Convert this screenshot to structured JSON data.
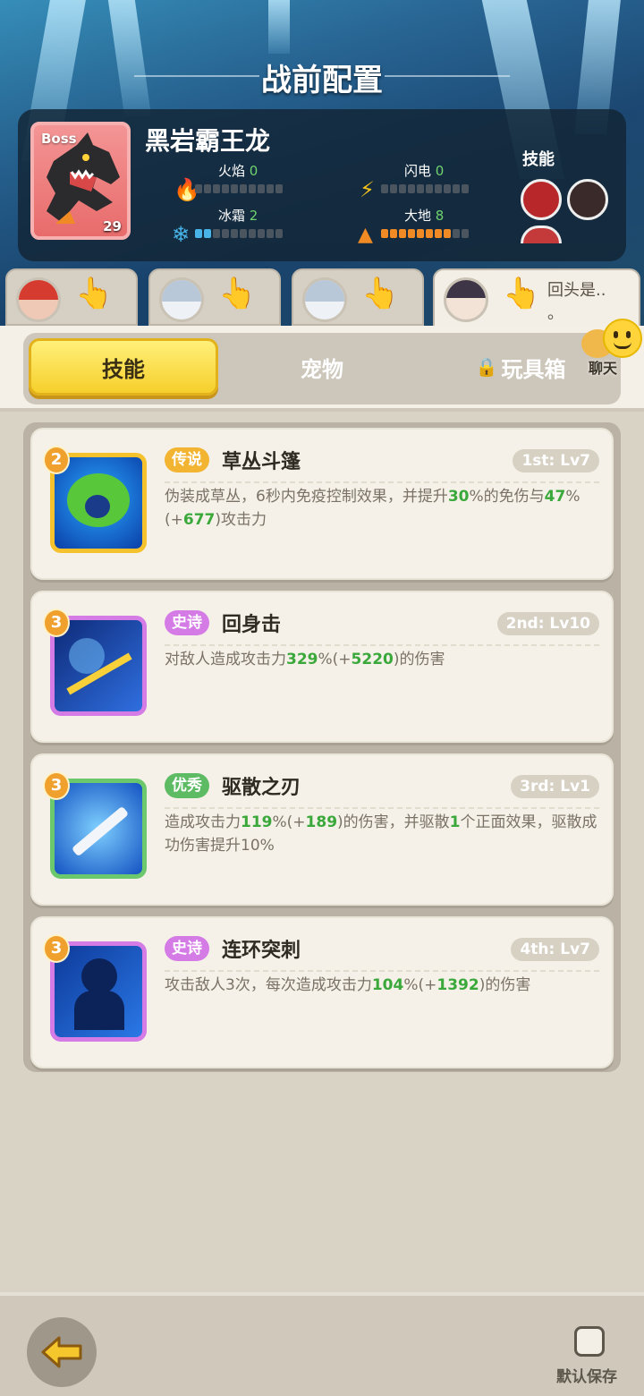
{
  "header": {
    "title": "战前配置"
  },
  "boss": {
    "tag": "Boss",
    "name": "黑岩霸王龙",
    "level": "29",
    "stats": [
      {
        "label": "火焰",
        "value": "0",
        "color": "#e0452b",
        "icon": "fire-icon"
      },
      {
        "label": "闪电",
        "value": "0",
        "color": "#f5c21c",
        "icon": "lightning-icon"
      },
      {
        "label": "冰霜",
        "value": "2",
        "color": "#48b4e8",
        "icon": "snowflake-icon"
      },
      {
        "label": "大地",
        "value": "8",
        "color": "#f08a24",
        "icon": "earth-icon"
      }
    ],
    "skills_label": "技能"
  },
  "characters": [
    {
      "name": "red-hair-hero",
      "message": ""
    },
    {
      "name": "silver-hair-hero-1",
      "message": ""
    },
    {
      "name": "silver-hair-hero-2",
      "message": ""
    },
    {
      "name": "dark-hair-hero",
      "message": "回头是..",
      "message2": "。"
    }
  ],
  "tabs": [
    {
      "label": "技能",
      "active": true
    },
    {
      "label": "宠物",
      "active": false
    },
    {
      "label": "玩具箱",
      "active": false,
      "locked": true
    }
  ],
  "chat": {
    "label": "聊天"
  },
  "skills": [
    {
      "badge": "2",
      "rarity": "传说",
      "rarity_color": "#f2b431",
      "name": "草丛斗篷",
      "slot": "1st: Lv7",
      "desc_parts": [
        "伪装成草丛，6秒内免疫控制效果，并提升",
        "30",
        "%的免伤与",
        "47",
        "%(+",
        "677",
        ")攻击力"
      ],
      "frame_color": "#f5c22e",
      "bg": "#1d6fd8"
    },
    {
      "badge": "3",
      "rarity": "史诗",
      "rarity_color": "#d47be6",
      "name": "回身击",
      "slot": "2nd: Lv10",
      "desc_parts": [
        "对敌人造成攻击力",
        "329",
        "%(+",
        "5220",
        ")的伤害"
      ],
      "frame_color": "#d47be6",
      "bg": "#1b3a8f"
    },
    {
      "badge": "3",
      "rarity": "优秀",
      "rarity_color": "#5dbb63",
      "name": "驱散之刃",
      "slot": "3rd: Lv1",
      "desc_parts": [
        "造成攻击力",
        "119",
        "%(+",
        "189",
        ")的伤害，并驱散",
        "1",
        "个正面效果，驱散成功伤害提升10%"
      ],
      "frame_color": "#6cc86c",
      "bg": "#1e6fd9"
    },
    {
      "badge": "3",
      "rarity": "史诗",
      "rarity_color": "#d47be6",
      "name": "连环突刺",
      "slot": "4th: Lv7",
      "desc_parts": [
        "攻击敌人3次，每次造成攻击力",
        "104",
        "%(+",
        "1392",
        ")的伤害"
      ],
      "frame_color": "#d47be6",
      "bg": "#1b4fb8"
    }
  ],
  "footer": {
    "save_label": "默认保存"
  }
}
